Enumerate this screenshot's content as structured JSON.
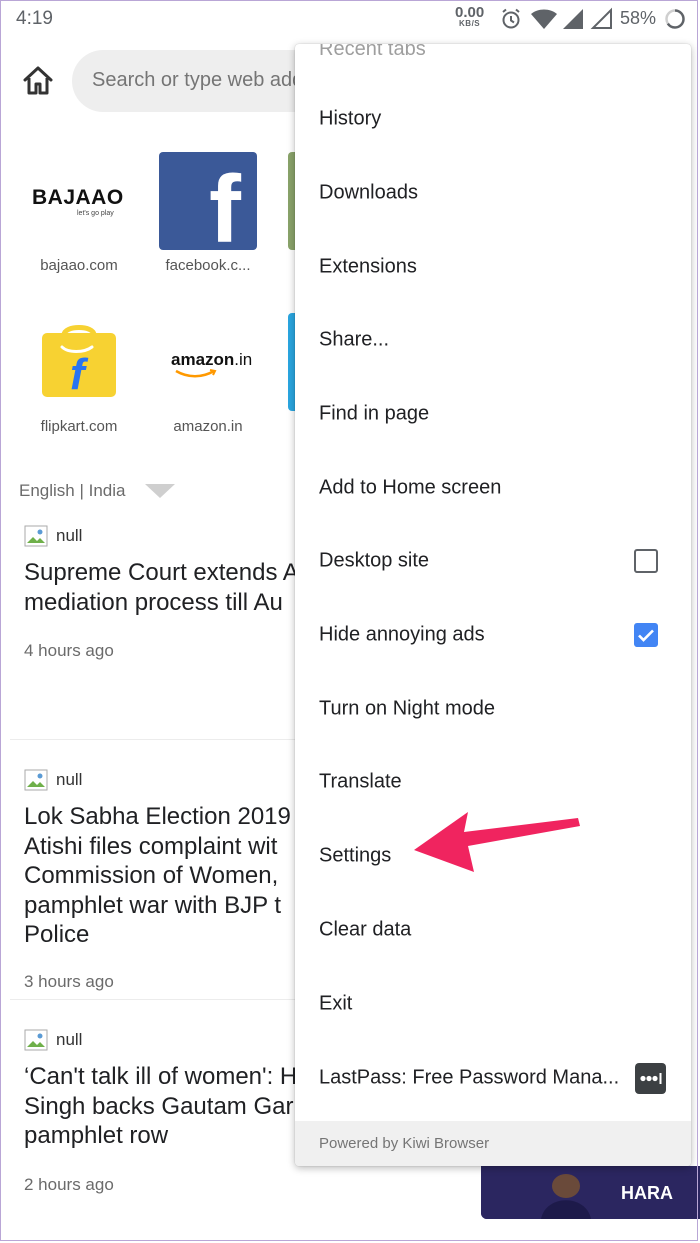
{
  "status_bar": {
    "time": "4:19",
    "speed_value": "0.00",
    "speed_unit": "KB/S",
    "battery": "58%"
  },
  "toolbar": {
    "search_placeholder": "Search or type web address"
  },
  "speed_dial": [
    {
      "label": "bajaao.com",
      "logo_text": "BAJAAO",
      "tagline": "let's go play"
    },
    {
      "label": "facebook.c...",
      "logo_text": "f"
    },
    {
      "label": "flipkart.com",
      "logo_text": "f"
    },
    {
      "label": "amazon.in",
      "logo_text": "amazon",
      "logo_suffix": ".in"
    }
  ],
  "language_selector": "English | India",
  "news": [
    {
      "source": "null",
      "title_lines": [
        "Supreme Court extends A",
        "mediation process till Au"
      ],
      "time": "4 hours ago"
    },
    {
      "source": "null",
      "title_lines": [
        "Lok Sabha Election 2019",
        "Atishi files complaint wit",
        "Commission of Women,",
        "pamphlet war with BJP t",
        "Police"
      ],
      "time": "3 hours ago"
    },
    {
      "source": "null",
      "title_lines": [
        "‘Can't talk ill of women': H",
        "Singh backs Gautam Gar",
        "pamphlet row"
      ],
      "time": "2 hours ago"
    }
  ],
  "menu": {
    "partial_top_item": "Recent tabs",
    "items": [
      {
        "label": "History"
      },
      {
        "label": "Downloads"
      },
      {
        "label": "Extensions"
      },
      {
        "label": "Share..."
      },
      {
        "label": "Find in page"
      },
      {
        "label": "Add to Home screen"
      },
      {
        "label": "Desktop site",
        "checkbox": false
      },
      {
        "label": "Hide annoying ads",
        "checkbox": true
      },
      {
        "label": "Turn on Night mode"
      },
      {
        "label": "Translate"
      },
      {
        "label": "Settings"
      },
      {
        "label": "Clear data"
      },
      {
        "label": "Exit"
      },
      {
        "label": "LastPass: Free Password Mana...",
        "icon": "lastpass-icon"
      }
    ],
    "footer": "Powered by Kiwi Browser"
  },
  "colors": {
    "checkbox_checked": "#4285f4",
    "arrow": "#f0245f",
    "facebook": "#3b5998",
    "flipkart": "#f7d232"
  }
}
